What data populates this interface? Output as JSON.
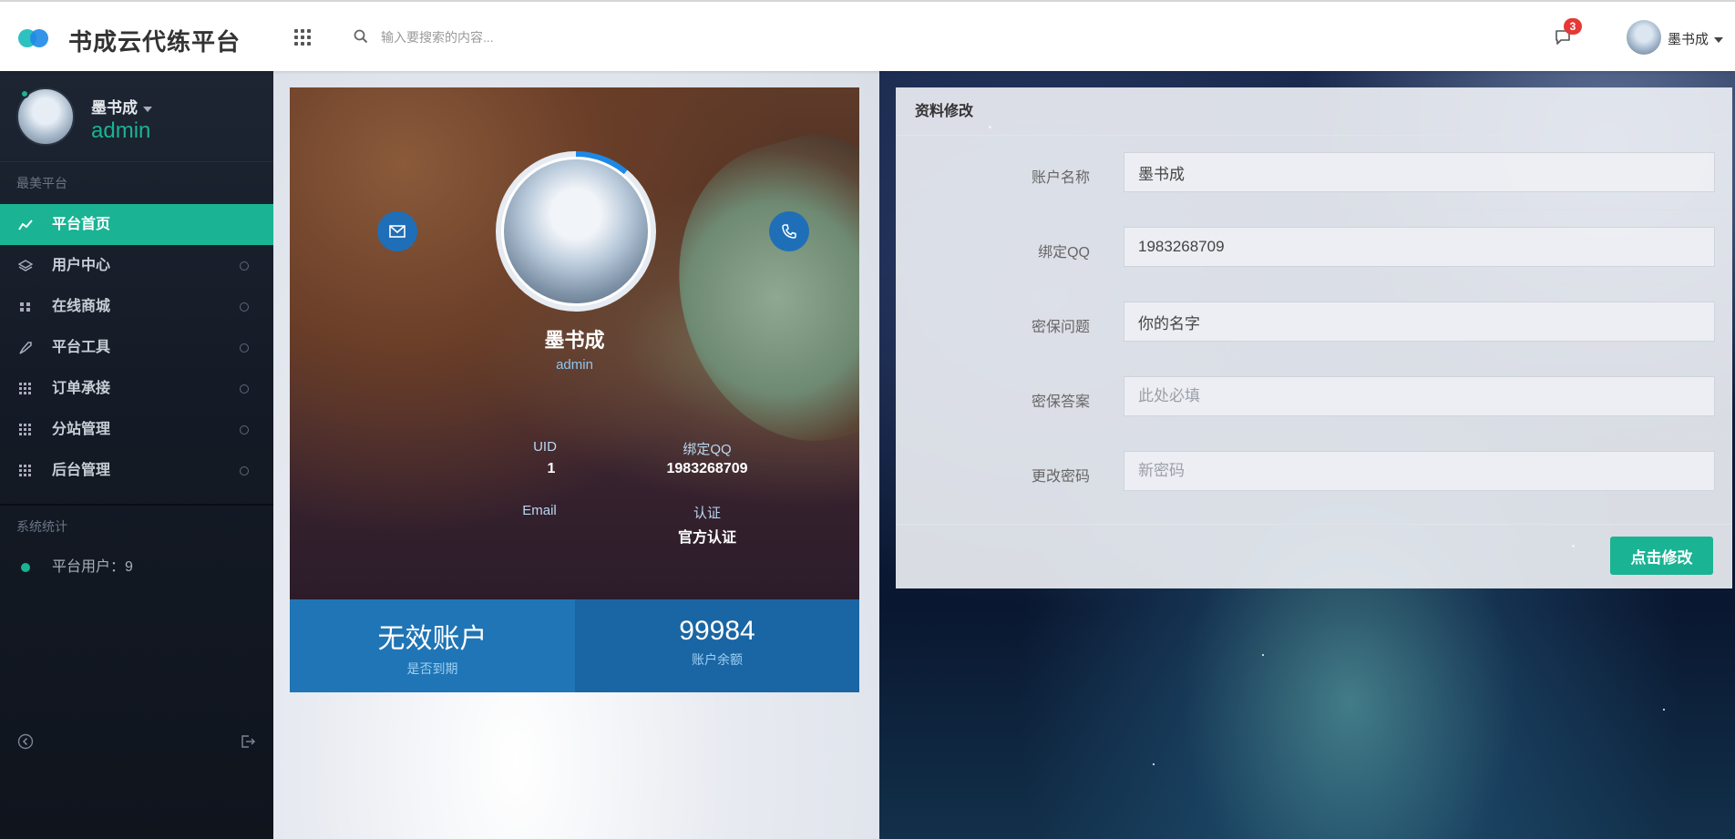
{
  "header": {
    "brand": "书成云代练平台",
    "search_placeholder": "输入要搜索的内容...",
    "notification_count": "3",
    "username": "墨书成"
  },
  "sidebar": {
    "user_name": "墨书成",
    "user_role": "admin",
    "section_title": "最美平台",
    "items": [
      {
        "label": "平台首页",
        "icon": "chart-line-icon",
        "active": true
      },
      {
        "label": "用户中心",
        "icon": "layers-icon"
      },
      {
        "label": "在线商城",
        "icon": "apps-icon"
      },
      {
        "label": "平台工具",
        "icon": "rocket-icon"
      },
      {
        "label": "订单承接",
        "icon": "grid-icon"
      },
      {
        "label": "分站管理",
        "icon": "grid-icon"
      },
      {
        "label": "后台管理",
        "icon": "grid-icon"
      }
    ],
    "stats_title": "系统统计",
    "stats": [
      {
        "label": "平台用户：9"
      }
    ]
  },
  "profile": {
    "name": "墨书成",
    "role": "admin",
    "uid_label": "UID",
    "uid_value": "1",
    "qq_label": "绑定QQ",
    "qq_value": "1983268709",
    "email_label": "Email",
    "email_value": "",
    "auth_label": "认证",
    "auth_value": "官方认证",
    "stat_left_value": "无效账户",
    "stat_left_label": "是否到期",
    "stat_right_value": "99984",
    "stat_right_label": "账户余额"
  },
  "edit_form": {
    "title": "资料修改",
    "fields": [
      {
        "label": "账户名称",
        "value": "墨书成",
        "placeholder": ""
      },
      {
        "label": "绑定QQ",
        "value": "1983268709",
        "placeholder": ""
      },
      {
        "label": "密保问题",
        "value": "你的名字",
        "placeholder": ""
      },
      {
        "label": "密保答案",
        "value": "",
        "placeholder": "此处必填"
      },
      {
        "label": "更改密码",
        "value": "",
        "placeholder": "新密码"
      }
    ],
    "submit_label": "点击修改"
  },
  "colors": {
    "accent": "#1ab394",
    "primary_blue": "#1e75b5",
    "badge_red": "#e53935",
    "sidebar_bg": "#1d2533"
  }
}
